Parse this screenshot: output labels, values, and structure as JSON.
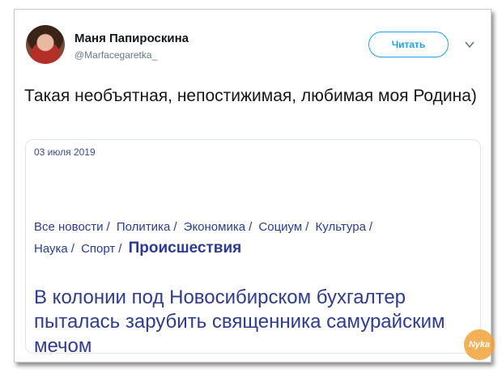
{
  "tweet": {
    "author_name": "Маня Папироскина",
    "author_handle": "@Marfacegaretka_",
    "follow_label": "Читать",
    "text": "Такая необъятная, непостижимая, любимая моя Родина)"
  },
  "media": {
    "date": "03 июля 2019",
    "nav_items": [
      "Все новости",
      "Политика",
      "Экономика",
      "Социум",
      "Культура",
      "Наука",
      "Спорт"
    ],
    "nav_active": "Происшествия",
    "headline": "В колонии под Новосибирском бухгалтер пыталась зарубить священника самурайским мечом"
  },
  "watermark": "Nyka",
  "colors": {
    "accent": "#1da1f2",
    "text": "#14171a",
    "muted": "#657786",
    "news_blue": "#2f3c8e"
  }
}
